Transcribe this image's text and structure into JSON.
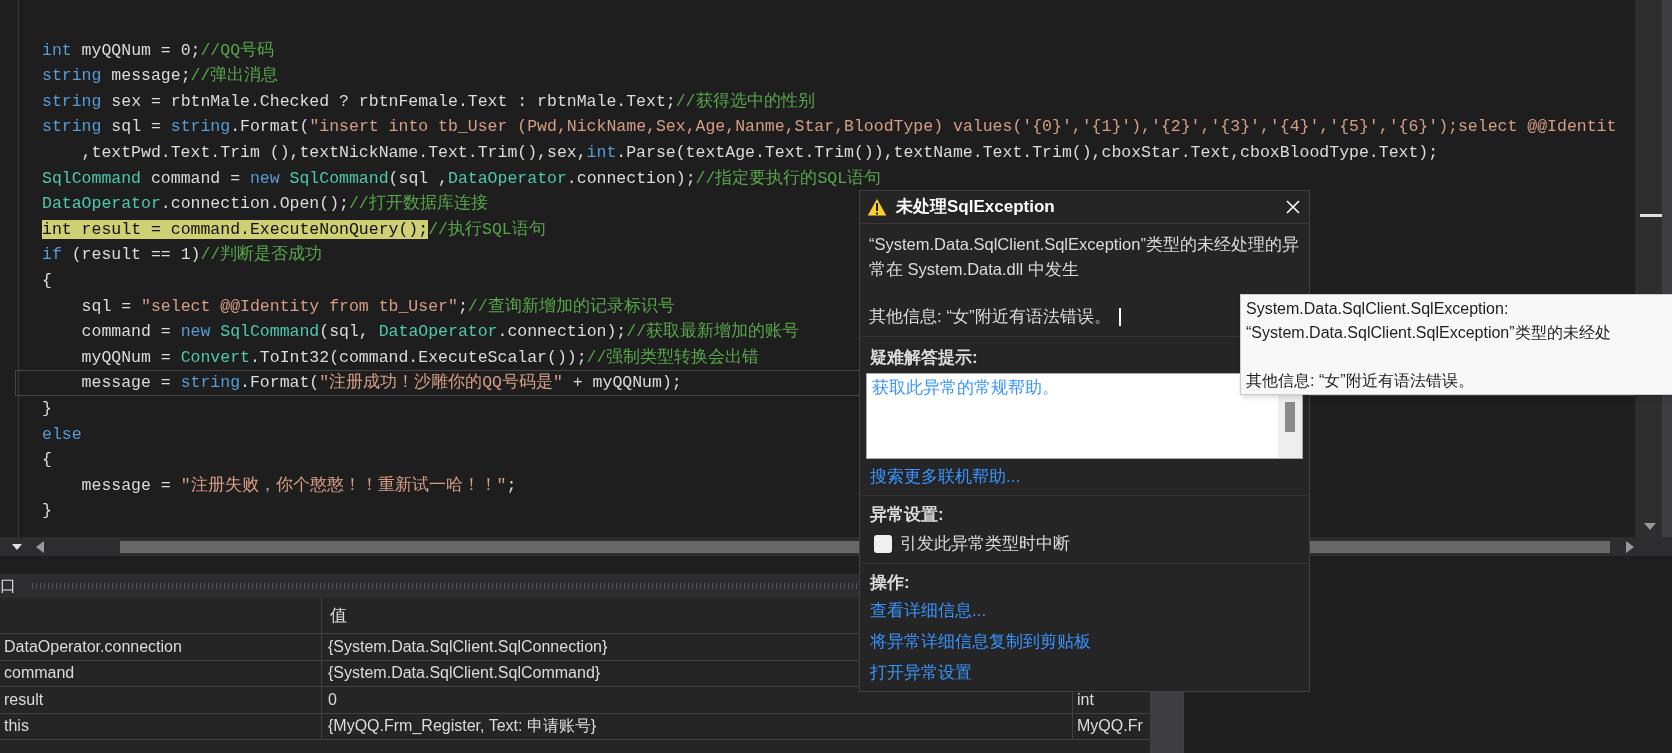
{
  "editor": {
    "lines": [
      {
        "kind": "blank"
      },
      {
        "highlighted": false,
        "outlined": false,
        "tokens": [
          {
            "kind": "keyword",
            "text": "int"
          },
          {
            "kind": "plain",
            "text": " myQQNum = 0;"
          },
          {
            "kind": "comment",
            "text": "//QQ号码"
          }
        ]
      },
      {
        "highlighted": false,
        "outlined": false,
        "tokens": [
          {
            "kind": "keyword",
            "text": "string"
          },
          {
            "kind": "plain",
            "text": " message;"
          },
          {
            "kind": "comment",
            "text": "//弹出消息"
          }
        ]
      },
      {
        "highlighted": false,
        "outlined": false,
        "tokens": [
          {
            "kind": "keyword",
            "text": "string"
          },
          {
            "kind": "plain",
            "text": " sex = rbtnMale.Checked ? rbtnFemale.Text : rbtnMale.Text;"
          },
          {
            "kind": "comment",
            "text": "//获得选中的性别"
          }
        ]
      },
      {
        "highlighted": false,
        "outlined": false,
        "tokens": [
          {
            "kind": "keyword",
            "text": "string"
          },
          {
            "kind": "plain",
            "text": " sql = "
          },
          {
            "kind": "keyword",
            "text": "string"
          },
          {
            "kind": "plain",
            "text": ".Format("
          },
          {
            "kind": "string",
            "text": "\"insert into tb_User (Pwd,NickName,Sex,Age,Nanme,Star,BloodType) values('{0}','{1}'),'{2}','{3}','{4}','{5}','{6}');select @@Identit"
          }
        ]
      },
      {
        "highlighted": false,
        "outlined": false,
        "tokens": [
          {
            "kind": "plain",
            "text": "    ,textPwd.Text.Trim (),textNickName.Text.Trim(),sex,"
          },
          {
            "kind": "keyword",
            "text": "int"
          },
          {
            "kind": "plain",
            "text": ".Parse(textAge.Text.Trim()),textName.Text.Trim(),cboxStar.Text,cboxBloodType.Text);"
          }
        ]
      },
      {
        "highlighted": false,
        "outlined": false,
        "tokens": [
          {
            "kind": "type",
            "text": "SqlCommand"
          },
          {
            "kind": "plain",
            "text": " command = "
          },
          {
            "kind": "keyword",
            "text": "new "
          },
          {
            "kind": "type",
            "text": "SqlCommand"
          },
          {
            "kind": "plain",
            "text": "(sql ,"
          },
          {
            "kind": "type",
            "text": "DataOperator"
          },
          {
            "kind": "plain",
            "text": ".connection);"
          },
          {
            "kind": "comment",
            "text": "//指定要执行的SQL语句"
          }
        ]
      },
      {
        "highlighted": false,
        "outlined": false,
        "tokens": [
          {
            "kind": "type",
            "text": "DataOperator"
          },
          {
            "kind": "plain",
            "text": ".connection.Open();"
          },
          {
            "kind": "comment",
            "text": "//打开数据库连接"
          }
        ]
      },
      {
        "highlighted": true,
        "outlined": false,
        "tokens": [
          {
            "kind": "keyword",
            "text": "int"
          },
          {
            "kind": "plain",
            "text": " result = command.ExecuteNonQuery();"
          },
          {
            "kind": "comment",
            "text": "//执行SQL语句"
          }
        ]
      },
      {
        "highlighted": false,
        "outlined": false,
        "tokens": [
          {
            "kind": "keyword",
            "text": "if"
          },
          {
            "kind": "plain",
            "text": " (result == 1)"
          },
          {
            "kind": "comment",
            "text": "//判断是否成功"
          }
        ]
      },
      {
        "highlighted": false,
        "outlined": false,
        "tokens": [
          {
            "kind": "plain",
            "text": "{"
          }
        ]
      },
      {
        "highlighted": false,
        "outlined": false,
        "tokens": [
          {
            "kind": "plain",
            "text": "    sql = "
          },
          {
            "kind": "string",
            "text": "\"select @@Identity from tb_User\""
          },
          {
            "kind": "plain",
            "text": ";"
          },
          {
            "kind": "comment",
            "text": "//查询新增加的记录标识号"
          }
        ]
      },
      {
        "highlighted": false,
        "outlined": false,
        "tokens": [
          {
            "kind": "plain",
            "text": "    command = "
          },
          {
            "kind": "keyword",
            "text": "new "
          },
          {
            "kind": "type",
            "text": "SqlCommand"
          },
          {
            "kind": "plain",
            "text": "(sql, "
          },
          {
            "kind": "type",
            "text": "DataOperator"
          },
          {
            "kind": "plain",
            "text": ".connection);"
          },
          {
            "kind": "comment",
            "text": "//获取最新增加的账号"
          }
        ]
      },
      {
        "highlighted": false,
        "outlined": false,
        "tokens": [
          {
            "kind": "plain",
            "text": "    myQQNum = "
          },
          {
            "kind": "type",
            "text": "Convert"
          },
          {
            "kind": "plain",
            "text": ".ToInt32(command.ExecuteScalar());"
          },
          {
            "kind": "comment",
            "text": "//强制类型转换会出错"
          }
        ]
      },
      {
        "highlighted": false,
        "outlined": true,
        "tokens": [
          {
            "kind": "plain",
            "text": "    message = "
          },
          {
            "kind": "keyword",
            "text": "string"
          },
          {
            "kind": "plain",
            "text": ".Format("
          },
          {
            "kind": "string",
            "text": "\"注册成功！沙雕你的QQ号码是\""
          },
          {
            "kind": "plain",
            "text": " + myQQNum);"
          }
        ]
      },
      {
        "highlighted": false,
        "outlined": false,
        "tokens": [
          {
            "kind": "plain",
            "text": "}"
          }
        ]
      },
      {
        "highlighted": false,
        "outlined": false,
        "tokens": [
          {
            "kind": "keyword",
            "text": "else"
          }
        ]
      },
      {
        "highlighted": false,
        "outlined": false,
        "tokens": [
          {
            "kind": "plain",
            "text": "{"
          }
        ]
      },
      {
        "highlighted": false,
        "outlined": false,
        "tokens": [
          {
            "kind": "plain",
            "text": "    message = "
          },
          {
            "kind": "string",
            "text": "\"注册失败，你个憨憨！！重新试一哈！！\""
          },
          {
            "kind": "plain",
            "text": ";"
          }
        ]
      },
      {
        "highlighted": false,
        "outlined": false,
        "tokens": [
          {
            "kind": "plain",
            "text": "}"
          }
        ]
      }
    ]
  },
  "locals": {
    "panel_title": "口",
    "value_heading": "值",
    "rows": [
      {
        "name": "DataOperator.connection",
        "value": "{System.Data.SqlClient.SqlConnection}"
      },
      {
        "name": "command",
        "value": "{System.Data.SqlClient.SqlCommand}"
      },
      {
        "name": "result",
        "value": "0",
        "type": "int"
      },
      {
        "name": "this",
        "value": "{MyQQ.Frm_Register, Text: 申请账号}",
        "type": "MyQQ.Fr"
      }
    ]
  },
  "exception_dialog": {
    "title": "未处理SqlException",
    "message": "“System.Data.SqlClient.SqlException”类型的未经处理的异常在 System.Data.dll 中发生",
    "additional_info": "其他信息: “女”附近有语法错误。",
    "troubleshooting": {
      "heading": "疑难解答提示:",
      "tips": [
        "获取此异常的常规帮助。"
      ],
      "more_help_link": "搜索更多联机帮助..."
    },
    "settings": {
      "heading": "异常设置:",
      "options": [
        {
          "label": "引发此异常类型时中断",
          "checked": false
        }
      ]
    },
    "actions": {
      "heading": "操作:",
      "links": [
        "查看详细信息...",
        "将异常详细信息复制到剪贴板",
        "打开异常设置"
      ]
    }
  },
  "tooltip": {
    "lines": [
      "System.Data.SqlClient.SqlException:",
      "“System.Data.SqlClient.SqlException”类型的未经处"
    ],
    "detail": "其他信息: “女”附近有语法错误。"
  }
}
